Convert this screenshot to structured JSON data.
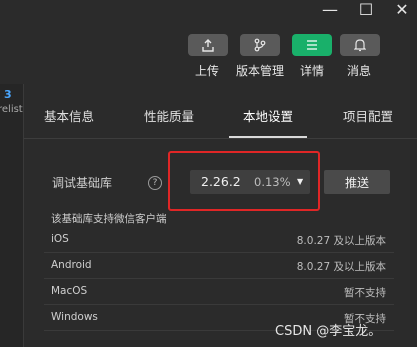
{
  "window": {
    "minimize_glyph": "—",
    "maximize_glyph": "☐",
    "close_glyph": "✕"
  },
  "toolbar": {
    "upload_label": "上传",
    "version_label": "版本管理",
    "details_label": "详情",
    "messages_label": "消息"
  },
  "sidebar": {
    "fragment_text": "relist"
  },
  "tabs": [
    {
      "label": "基本信息"
    },
    {
      "label": "性能质量"
    },
    {
      "label": "本地设置"
    },
    {
      "label": "项目配置"
    }
  ],
  "debug_lib": {
    "label": "调试基础库",
    "help_glyph": "?",
    "version": "2.26.2",
    "usage_percent": "0.13%",
    "push_label": "推送"
  },
  "support": {
    "title": "该基础库支持微信客户端",
    "rows": [
      {
        "name": "iOS",
        "value": "8.0.27 及以上版本"
      },
      {
        "name": "Android",
        "value": "8.0.27 及以上版本"
      },
      {
        "name": "MacOS",
        "value": "暂不支持"
      },
      {
        "name": "Windows",
        "value": "暂不支持"
      }
    ]
  },
  "watermark": "CSDN @李宝龙。",
  "colors": {
    "background": "#2b2b2b",
    "active_button": "#19b06a",
    "highlight_box": "#e02626"
  }
}
